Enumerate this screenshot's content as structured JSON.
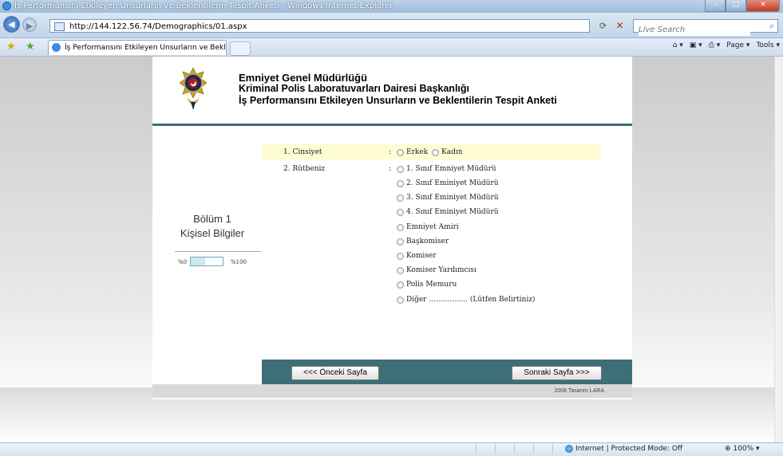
{
  "browser": {
    "window_title": "İş Performansını Etkileyen Unsurların ve Beklentilerin Tespit Anketi - Windows Internet Explorer",
    "address": "http://144.122.56.74/Demographics/01.aspx",
    "search_placeholder": "Live Search",
    "tab_title": "İş Performansını Etkileyen Unsurların ve Beklentil...",
    "commands": {
      "page": "Page ▾",
      "tools": "Tools ▾"
    },
    "status": {
      "zone": "Internet | Protected Mode: Off",
      "zoom": "100%"
    }
  },
  "header": {
    "line1": "Emniyet Genel Müdürlüğü",
    "line2": "Kriminal Polis Laboratuvarları Dairesi Başkanlığı",
    "line3": "İş Performansını Etkileyen Unsurların ve Beklentilerin Tespit Anketi"
  },
  "section": {
    "title": "Bölüm 1",
    "subtitle": "Kişisel Bilgiler",
    "progress_left": "%0",
    "progress_right": "%100",
    "progress_value": 0.45
  },
  "questions": {
    "q1": {
      "label": "1. Cinsiyet",
      "sep": ":",
      "options": [
        "Erkek",
        "Kadın"
      ]
    },
    "q2": {
      "label": "2. Rütbeniz",
      "sep": ":",
      "options": [
        "1. Sınıf Emniyet Müdürü",
        "2. Sınıf Eminiyet Müdürü",
        "3. Sınıf Eminiyet Müdürü",
        "4. Sınıf Eminiyet Müdürü",
        "Emniyet Amiri",
        "Başkomiser",
        "Komiser",
        "Komiser Yardımcısı",
        "Polis Memuru",
        "Diğer ................. (Lütfen Belirtiniz)"
      ]
    }
  },
  "nav": {
    "prev": "<<< Önceki Sayfa",
    "next": "Sonraki Sayfa >>>"
  },
  "footer": {
    "copyright": "2008   Tasarım LARA"
  },
  "colors": {
    "accent": "#3e6e77",
    "highlight_row": "#fffdd6",
    "footer_bg": "#d9d9d9"
  }
}
